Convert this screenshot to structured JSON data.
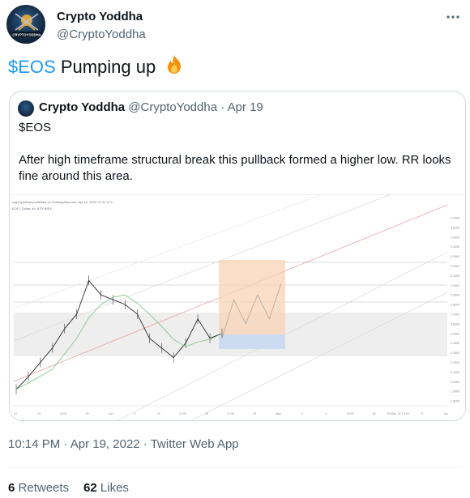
{
  "author": {
    "display_name": "Crypto Yoddha",
    "handle": "@CryptoYoddha",
    "avatar_text": "CRYPTOYODDHA"
  },
  "more_icon": "more-horizontal-icon",
  "tweet": {
    "cashtag": "$EOS",
    "text_rest": " Pumping up",
    "emoji": "fire-icon"
  },
  "quoted": {
    "display_name": "Crypto Yoddha",
    "handle": "@CryptoYoddha",
    "dot": "·",
    "date": "Apr 19",
    "line1": "$EOS",
    "line2": "After high timeframe structural break this pullback formed a higher low. RR looks fine around this area."
  },
  "chart_header": {
    "line1": "cryptoyoddha published on TradingView.com, Apr 19, 2022 07:31 UTC",
    "line2": "EOS / Dollar, 4h, BITFINEX"
  },
  "chart_data": {
    "type": "line",
    "title": "",
    "series_name": "",
    "x": [
      "14",
      "21",
      "12:00",
      "28",
      "Apr",
      "5",
      "11",
      "12:00",
      "18",
      "12:00",
      "25",
      "May",
      "3",
      "9",
      "12:00",
      "16",
      "19 May '22 12:00",
      "27",
      "Jun"
    ],
    "price_axis": [
      "3.7000",
      "3.6000",
      "3.5000",
      "3.4000",
      "3.3000",
      "3.2000",
      "3.1000",
      "3.0000",
      "2.9000",
      "2.8000",
      "2.7000",
      "2.6000",
      "2.5000",
      "2.4000",
      "2.3000",
      "2.2000",
      "2.1000",
      "2.0000",
      "1.9000",
      "1.8000"
    ],
    "approx_prices": [
      1.92,
      2.05,
      2.2,
      2.35,
      2.55,
      2.7,
      3.05,
      2.9,
      2.85,
      2.8,
      2.7,
      2.45,
      2.35,
      2.25,
      2.4,
      2.65,
      2.45,
      2.5
    ],
    "projection": [
      2.45,
      2.85,
      2.6,
      2.9,
      2.65,
      3.02
    ],
    "ylim": [
      1.75,
      3.75
    ]
  },
  "posted": {
    "time": "10:14 PM",
    "sep": " · ",
    "date": "Apr 19, 2022",
    "client": "Twitter Web App"
  },
  "stats": {
    "retweets_count": "6",
    "retweets_label": "Retweets",
    "likes_count": "62",
    "likes_label": "Likes"
  },
  "colors": {
    "accent": "#1d9bf0",
    "text": "#0f1419",
    "muted": "#536471"
  }
}
